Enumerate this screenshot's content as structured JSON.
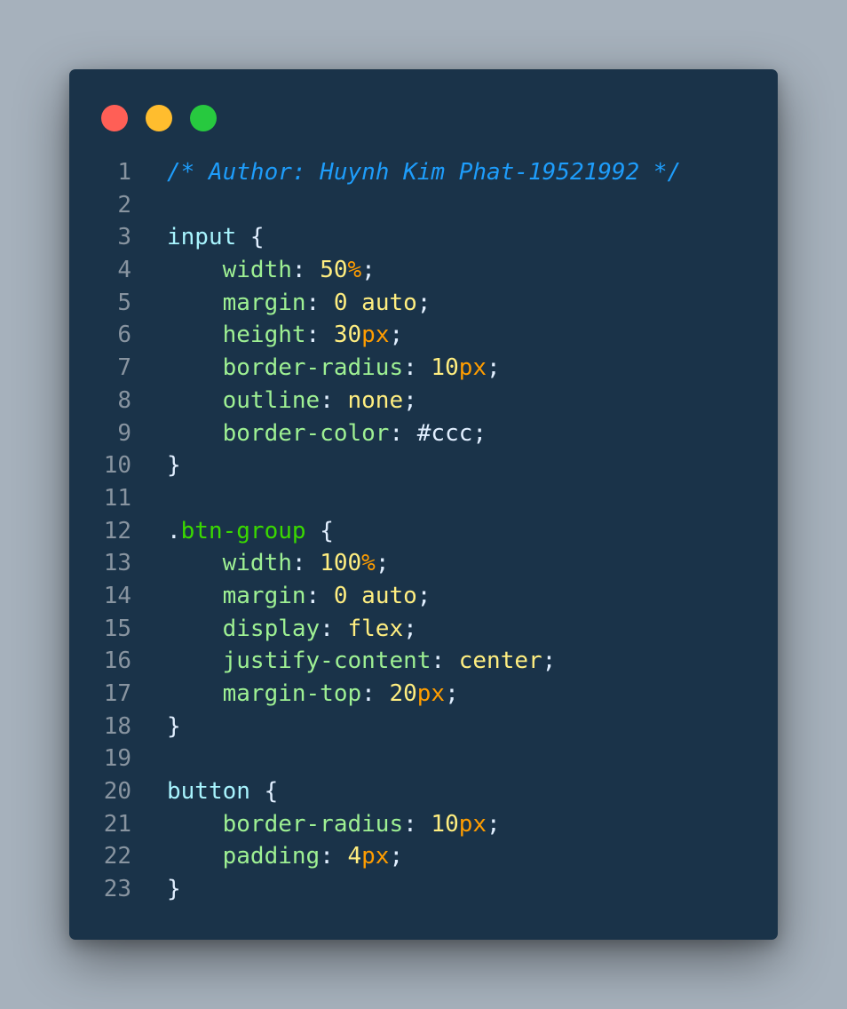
{
  "window": {
    "controls": {
      "close_color": "#ff5f56",
      "minimize_color": "#ffbd2e",
      "maximize_color": "#27c93f"
    }
  },
  "colors": {
    "background": "#a6b1bc",
    "window_background": "#1a3349",
    "line_number": "#8894a0",
    "comment": "#1e9dfb",
    "selector": "#a8f4fe",
    "class_selector": "#3ad900",
    "property": "#9ef093",
    "value": "#ffee80",
    "unit": "#ff9d00",
    "punctuation": "#e1efff"
  },
  "code": {
    "lines": [
      {
        "number": "1",
        "tokens": [
          {
            "t": "/* Author: Huynh Kim Phat-19521992 */",
            "c": "comment"
          }
        ]
      },
      {
        "number": "2",
        "tokens": []
      },
      {
        "number": "3",
        "tokens": [
          {
            "t": "input",
            "c": "selector"
          },
          {
            "t": " {",
            "c": "punctuation"
          }
        ]
      },
      {
        "number": "4",
        "tokens": [
          {
            "t": "    width",
            "c": "property"
          },
          {
            "t": ": ",
            "c": "punctuation"
          },
          {
            "t": "50",
            "c": "value"
          },
          {
            "t": "%",
            "c": "unit"
          },
          {
            "t": ";",
            "c": "punctuation"
          }
        ]
      },
      {
        "number": "5",
        "tokens": [
          {
            "t": "    margin",
            "c": "property"
          },
          {
            "t": ": ",
            "c": "punctuation"
          },
          {
            "t": "0 auto",
            "c": "value"
          },
          {
            "t": ";",
            "c": "punctuation"
          }
        ]
      },
      {
        "number": "6",
        "tokens": [
          {
            "t": "    height",
            "c": "property"
          },
          {
            "t": ": ",
            "c": "punctuation"
          },
          {
            "t": "30",
            "c": "value"
          },
          {
            "t": "px",
            "c": "unit"
          },
          {
            "t": ";",
            "c": "punctuation"
          }
        ]
      },
      {
        "number": "7",
        "tokens": [
          {
            "t": "    border-radius",
            "c": "property"
          },
          {
            "t": ": ",
            "c": "punctuation"
          },
          {
            "t": "10",
            "c": "value"
          },
          {
            "t": "px",
            "c": "unit"
          },
          {
            "t": ";",
            "c": "punctuation"
          }
        ]
      },
      {
        "number": "8",
        "tokens": [
          {
            "t": "    outline",
            "c": "property"
          },
          {
            "t": ": ",
            "c": "punctuation"
          },
          {
            "t": "none",
            "c": "value"
          },
          {
            "t": ";",
            "c": "punctuation"
          }
        ]
      },
      {
        "number": "9",
        "tokens": [
          {
            "t": "    border-color",
            "c": "property"
          },
          {
            "t": ": ",
            "c": "punctuation"
          },
          {
            "t": "#ccc",
            "c": "punctuation"
          },
          {
            "t": ";",
            "c": "punctuation"
          }
        ]
      },
      {
        "number": "10",
        "tokens": [
          {
            "t": "}",
            "c": "punctuation"
          }
        ]
      },
      {
        "number": "11",
        "tokens": []
      },
      {
        "number": "12",
        "tokens": [
          {
            "t": ".",
            "c": "punctuation"
          },
          {
            "t": "btn-group",
            "c": "class_selector"
          },
          {
            "t": " {",
            "c": "punctuation"
          }
        ]
      },
      {
        "number": "13",
        "tokens": [
          {
            "t": "    width",
            "c": "property"
          },
          {
            "t": ": ",
            "c": "punctuation"
          },
          {
            "t": "100",
            "c": "value"
          },
          {
            "t": "%",
            "c": "unit"
          },
          {
            "t": ";",
            "c": "punctuation"
          }
        ]
      },
      {
        "number": "14",
        "tokens": [
          {
            "t": "    margin",
            "c": "property"
          },
          {
            "t": ": ",
            "c": "punctuation"
          },
          {
            "t": "0 auto",
            "c": "value"
          },
          {
            "t": ";",
            "c": "punctuation"
          }
        ]
      },
      {
        "number": "15",
        "tokens": [
          {
            "t": "    display",
            "c": "property"
          },
          {
            "t": ": ",
            "c": "punctuation"
          },
          {
            "t": "flex",
            "c": "value"
          },
          {
            "t": ";",
            "c": "punctuation"
          }
        ]
      },
      {
        "number": "16",
        "tokens": [
          {
            "t": "    justify-content",
            "c": "property"
          },
          {
            "t": ": ",
            "c": "punctuation"
          },
          {
            "t": "center",
            "c": "value"
          },
          {
            "t": ";",
            "c": "punctuation"
          }
        ]
      },
      {
        "number": "17",
        "tokens": [
          {
            "t": "    margin-top",
            "c": "property"
          },
          {
            "t": ": ",
            "c": "punctuation"
          },
          {
            "t": "20",
            "c": "value"
          },
          {
            "t": "px",
            "c": "unit"
          },
          {
            "t": ";",
            "c": "punctuation"
          }
        ]
      },
      {
        "number": "18",
        "tokens": [
          {
            "t": "}",
            "c": "punctuation"
          }
        ]
      },
      {
        "number": "19",
        "tokens": []
      },
      {
        "number": "20",
        "tokens": [
          {
            "t": "button",
            "c": "selector"
          },
          {
            "t": " {",
            "c": "punctuation"
          }
        ]
      },
      {
        "number": "21",
        "tokens": [
          {
            "t": "    border-radius",
            "c": "property"
          },
          {
            "t": ": ",
            "c": "punctuation"
          },
          {
            "t": "10",
            "c": "value"
          },
          {
            "t": "px",
            "c": "unit"
          },
          {
            "t": ";",
            "c": "punctuation"
          }
        ]
      },
      {
        "number": "22",
        "tokens": [
          {
            "t": "    padding",
            "c": "property"
          },
          {
            "t": ": ",
            "c": "punctuation"
          },
          {
            "t": "4",
            "c": "value"
          },
          {
            "t": "px",
            "c": "unit"
          },
          {
            "t": ";",
            "c": "punctuation"
          }
        ]
      },
      {
        "number": "23",
        "tokens": [
          {
            "t": "}",
            "c": "punctuation"
          }
        ]
      }
    ]
  }
}
